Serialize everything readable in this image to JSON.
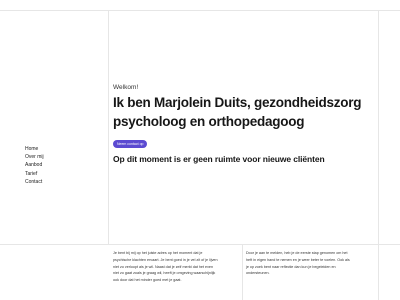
{
  "hero": {
    "welcome": "Welkom!",
    "title": "Ik ben Marjolein Duits, gezondheidszorg psycholoog en orthopedagoog",
    "cta_label": "Neem contact op",
    "subtitle": "Op dit moment is er geen ruimte voor nieuwe cliënten"
  },
  "nav": {
    "items": [
      {
        "label": "Home"
      },
      {
        "label": "Over mij"
      },
      {
        "label": "Aanbod"
      },
      {
        "label": "Tarief"
      },
      {
        "label": "Contact"
      }
    ]
  },
  "columns": {
    "left_lines": [
      "Je bent bij mij op het juiste adres op het moment dat je",
      "psychische klachten ervaart. Je bent goed in je vel zit of je lijven",
      "niet zo verloopt als je wil. Naast dat je zelf merkt dat het even",
      "niet zo gaat zoals je graag wil, heeft je omgeving waarschijnlijk",
      "ook door dat het minder goed met je gaat."
    ],
    "right_lines": [
      "Door je aan te melden, heb je de eerste stap genomen om het",
      "heft in eigen hand te nemen en je weer beter te voelen. Ook als",
      "je op zoek bent naar reflectie dan kun je begeleiden en",
      "ondersteunen."
    ]
  },
  "colors": {
    "accent": "#5b4ad1",
    "text": "#171717"
  }
}
